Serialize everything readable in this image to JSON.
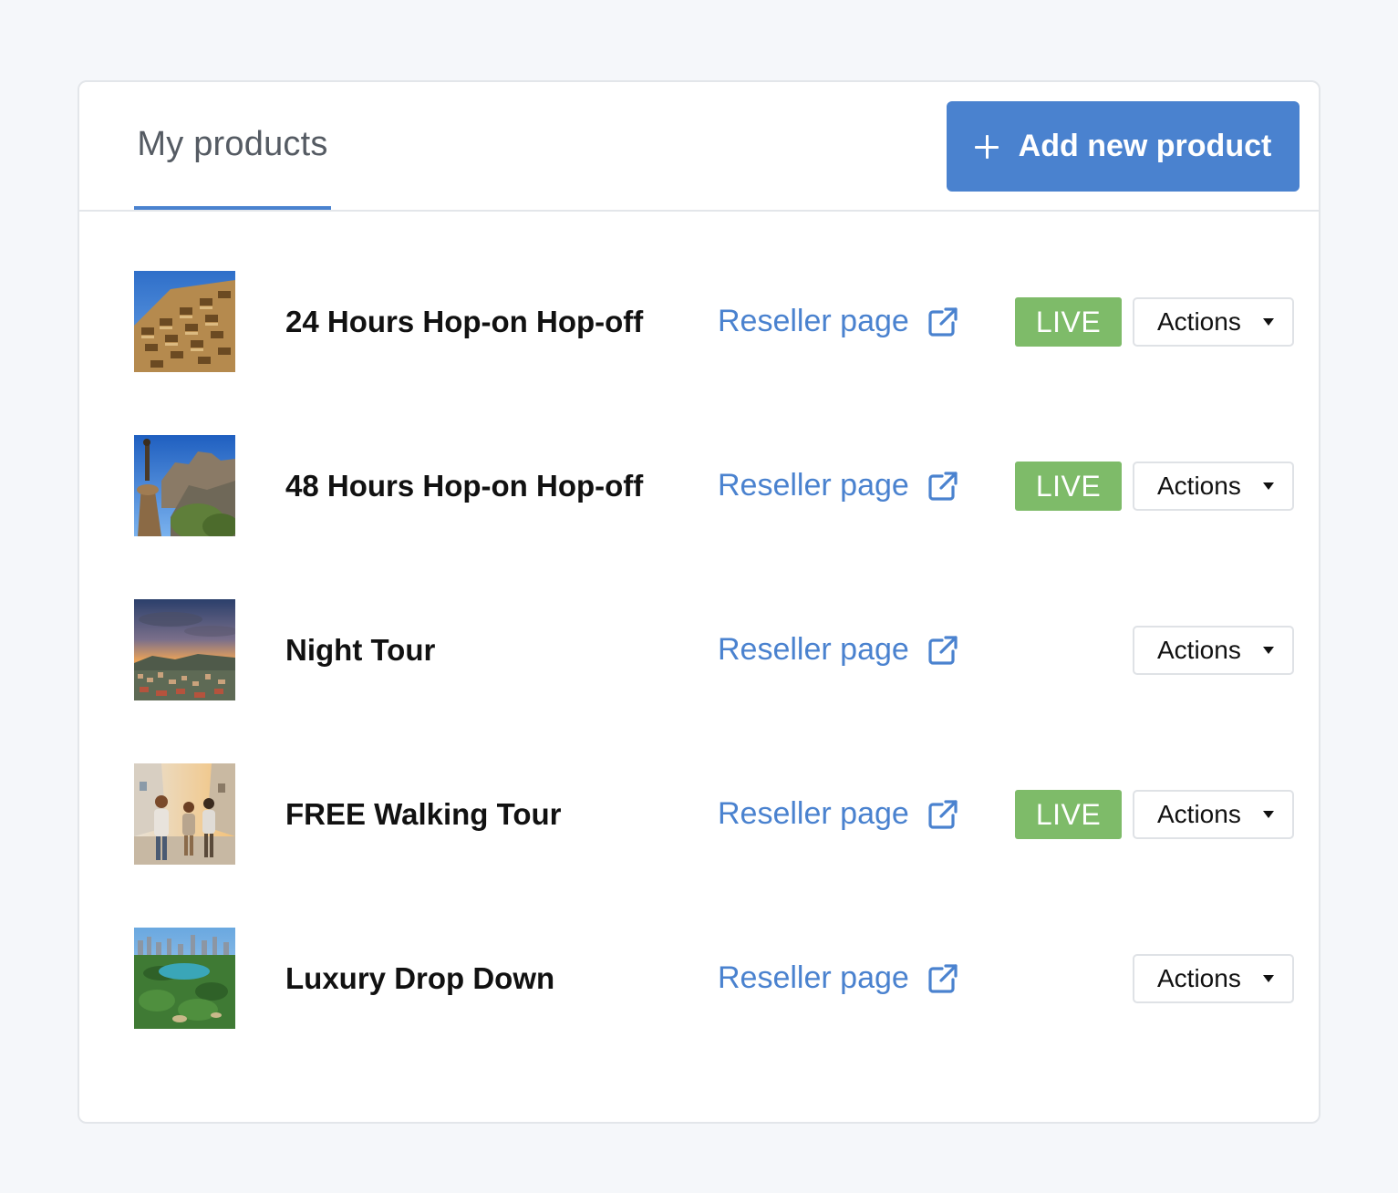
{
  "header": {
    "tab_label": "My products",
    "add_button_label": "Add new product"
  },
  "colors": {
    "accent": "#4a82cf",
    "live": "#7ebb69",
    "text": "#111111"
  },
  "products": [
    {
      "name": "24 Hours Hop-on Hop-off",
      "link_label": "Reseller page",
      "status": "LIVE",
      "actions_label": "Actions",
      "thumbnail": "building-facade-image"
    },
    {
      "name": "48 Hours Hop-on Hop-off",
      "link_label": "Reseller page",
      "status": "LIVE",
      "actions_label": "Actions",
      "thumbnail": "castle-hill-image"
    },
    {
      "name": "Night Tour",
      "link_label": "Reseller page",
      "status": "",
      "actions_label": "Actions",
      "thumbnail": "city-sunset-image"
    },
    {
      "name": "FREE Walking Tour",
      "link_label": "Reseller page",
      "status": "LIVE",
      "actions_label": "Actions",
      "thumbnail": "walking-tourists-image"
    },
    {
      "name": "Luxury Drop Down",
      "link_label": "Reseller page",
      "status": "",
      "actions_label": "Actions",
      "thumbnail": "park-aerial-image"
    }
  ]
}
